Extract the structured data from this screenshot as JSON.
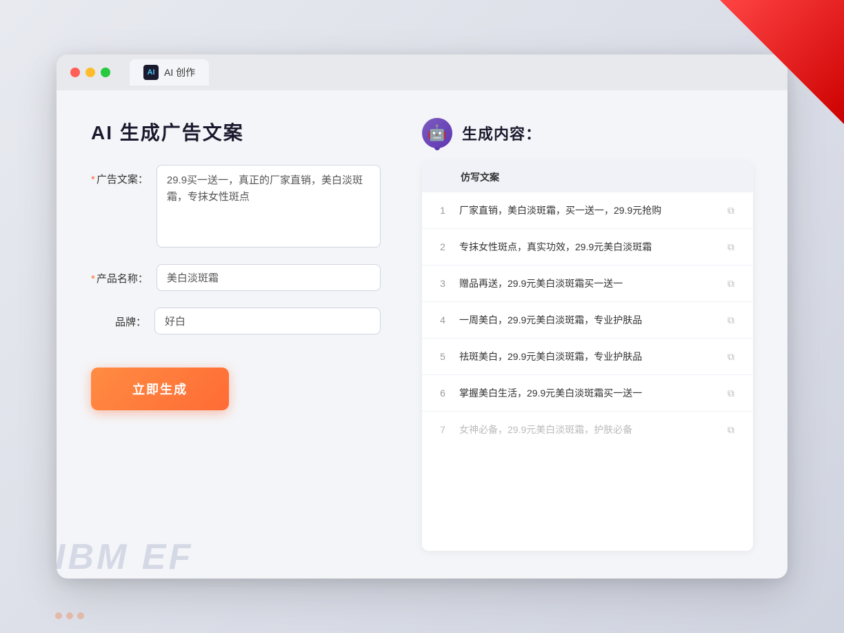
{
  "window": {
    "tab_title": "AI 创作",
    "tab_icon_text": "AI"
  },
  "left_panel": {
    "title": "AI 生成广告文案",
    "form": {
      "ad_copy_label": "广告文案：",
      "ad_copy_required": "*",
      "ad_copy_value": "29.9买一送一，真正的厂家直销，美白淡斑霜，专抹女性斑点",
      "product_name_label": "产品名称：",
      "product_name_required": "*",
      "product_name_value": "美白淡斑霜",
      "brand_label": "品牌：",
      "brand_value": "好白",
      "generate_btn": "立即生成"
    }
  },
  "right_panel": {
    "title": "生成内容：",
    "table_header": "仿写文案",
    "results": [
      {
        "num": "1",
        "text": "厂家直销，美白淡斑霜，买一送一，29.9元抢购",
        "faded": false
      },
      {
        "num": "2",
        "text": "专抹女性斑点，真实功效，29.9元美白淡斑霜",
        "faded": false
      },
      {
        "num": "3",
        "text": "赠品再送，29.9元美白淡斑霜买一送一",
        "faded": false
      },
      {
        "num": "4",
        "text": "一周美白，29.9元美白淡斑霜，专业护肤品",
        "faded": false
      },
      {
        "num": "5",
        "text": "祛斑美白，29.9元美白淡斑霜，专业护肤品",
        "faded": false
      },
      {
        "num": "6",
        "text": "掌握美白生活，29.9元美白淡斑霜买一送一",
        "faded": false
      },
      {
        "num": "7",
        "text": "女神必备，29.9元美白淡斑霜，护肤必备",
        "faded": true
      }
    ]
  },
  "bg": {
    "ibm_ef_text": "IBM EF"
  }
}
